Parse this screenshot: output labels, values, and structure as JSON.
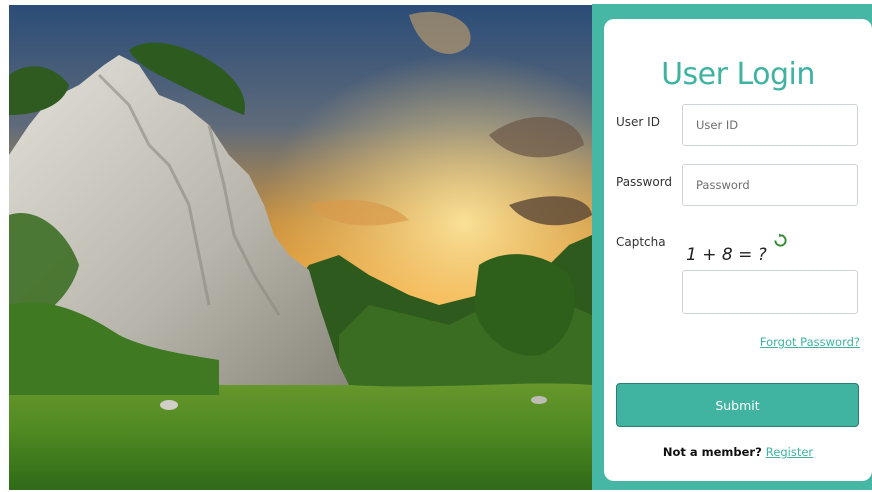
{
  "hero": {
    "image": "landscape-cliff-sunset"
  },
  "login": {
    "title": "User Login",
    "user_id_label": "User ID",
    "user_id_placeholder": "User ID",
    "user_id_value": "",
    "password_label": "Password",
    "password_placeholder": "Password",
    "password_value": "",
    "captcha_label": "Captcha",
    "captcha_text": "1 + 8 = ?",
    "captcha_value": "",
    "refresh_icon": "refresh-icon",
    "forgot_link": "Forgot Password?",
    "submit_label": "Submit",
    "footer_text": "Not a member?",
    "register_link": "Register"
  },
  "colors": {
    "accent": "#46b7a5",
    "button": "#41b3a1",
    "link": "#3fb3a1"
  }
}
